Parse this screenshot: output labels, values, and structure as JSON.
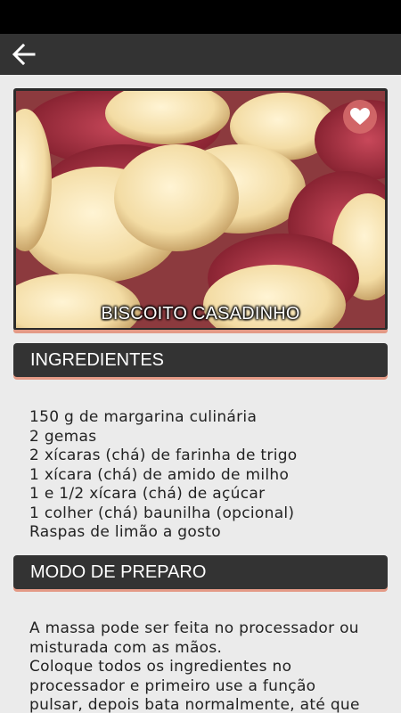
{
  "colors": {
    "app_bar": "#333333",
    "accent_underline": "#e49a86",
    "background": "#ebebeb",
    "favorite": "#d66c6c"
  },
  "toolbar": {
    "back_icon": "arrow-left-icon"
  },
  "recipe": {
    "title": "BISCOITO CASADINHO",
    "favorite_icon": "heart-icon"
  },
  "ingredients_section": {
    "title": "INGREDIENTES",
    "items": [
      "150 g de margarina culinária",
      "2 gemas",
      "2 xícaras (chá) de farinha de trigo",
      "1 xícara (chá) de amido de milho",
      "1 e 1/2 xícara (chá) de açúcar",
      "1 colher (chá) baunilha (opcional)",
      "Raspas de limão a gosto"
    ]
  },
  "method_section": {
    "title": "MODO DE PREPARO",
    "lines": [
      "A massa pode ser feita no processador ou",
      "misturada com as mãos.",
      "Coloque todos os ingredientes no",
      "processador e primeiro use a função",
      "pulsar, depois bata normalmente, até que"
    ]
  }
}
